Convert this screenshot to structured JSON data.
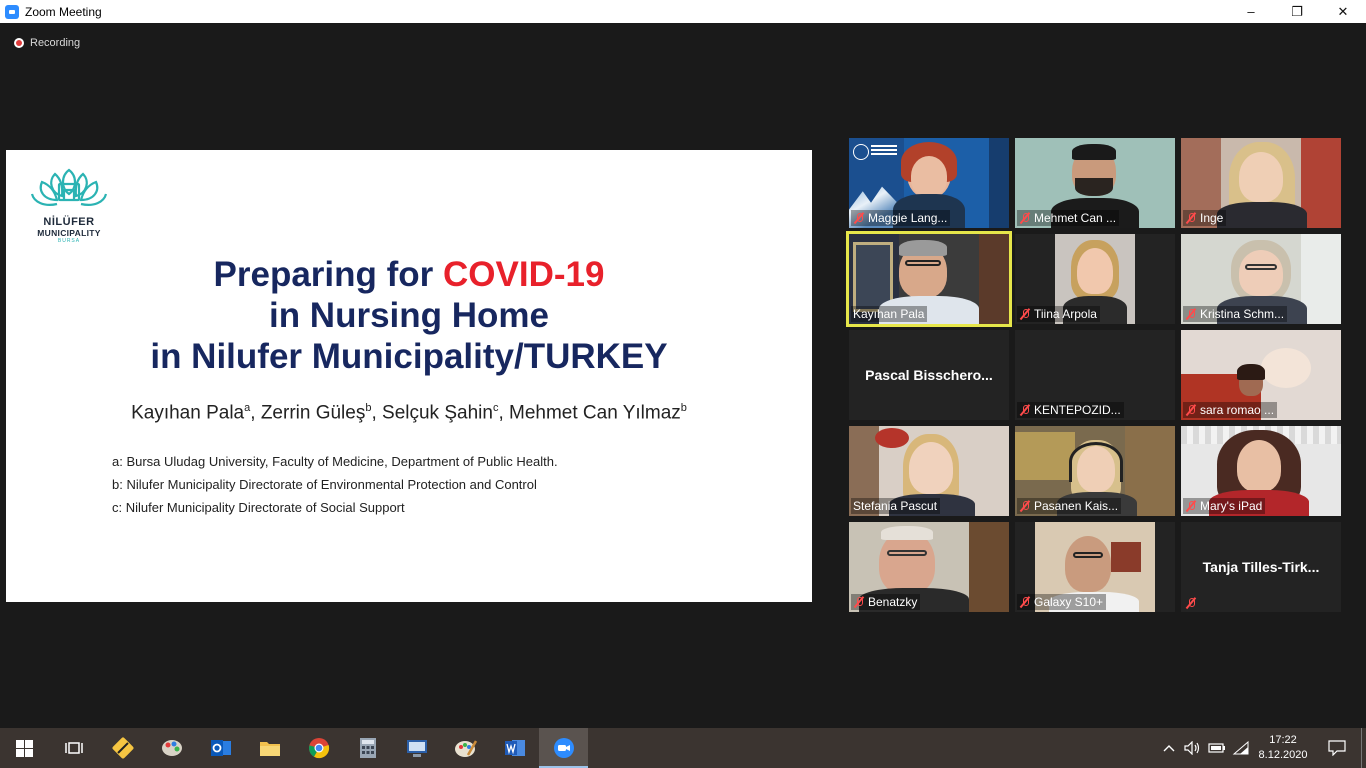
{
  "window": {
    "title": "Zoom Meeting",
    "minimize": "–",
    "restore": "❐",
    "close": "✕"
  },
  "recording": {
    "label": "Recording"
  },
  "slide": {
    "org_line1": "NİLÜFER",
    "org_line2": "MUNICIPALITY",
    "org_line3": "BURSA",
    "title_part1": "Preparing for ",
    "title_highlight": "COVID-19",
    "title_line2": "in Nursing Home",
    "title_line3": "in Nilufer Municipality/TURKEY",
    "authors": [
      {
        "name": "Kayıhan Pala",
        "sup": "a"
      },
      {
        "name": "Zerrin Güleş",
        "sup": "b"
      },
      {
        "name": "Selçuk Şahin",
        "sup": "c"
      },
      {
        "name": "Mehmet Can Yılmaz",
        "sup": "b"
      }
    ],
    "affiliations": [
      "a: Bursa Uludag University, Faculty of Medicine, Department of Public Health.",
      "b: Nilufer Municipality Directorate of Environmental Protection and Control",
      "c:  Nilufer Municipality Directorate of Social Support"
    ]
  },
  "participants": [
    {
      "name": "Maggie Lang...",
      "muted": true,
      "video": true
    },
    {
      "name": "Mehmet Can ...",
      "muted": true,
      "video": true
    },
    {
      "name": "Inge",
      "muted": true,
      "video": true
    },
    {
      "name": "Kayıhan Pala",
      "muted": false,
      "video": true,
      "speaking": true
    },
    {
      "name": "Tiina Arpola",
      "muted": true,
      "video": true
    },
    {
      "name": "Kristina Schm...",
      "muted": true,
      "video": true
    },
    {
      "name": "Pascal  Bisschero...",
      "muted": false,
      "video": false
    },
    {
      "name": "KENTEPOZID...",
      "muted": true,
      "video": false
    },
    {
      "name": "sara romao ...",
      "muted": true,
      "video": true
    },
    {
      "name": "Stefania Pascut",
      "muted": false,
      "video": true
    },
    {
      "name": "Pasanen Kais...",
      "muted": true,
      "video": true
    },
    {
      "name": "Mary's iPad",
      "muted": true,
      "video": true
    },
    {
      "name": "Benatzky",
      "muted": true,
      "video": true
    },
    {
      "name": "Galaxy S10+",
      "muted": true,
      "video": true
    },
    {
      "name": "Tanja  Tilles-Tirk...",
      "muted": true,
      "video": false
    }
  ],
  "taskbar": {
    "time": "17:22",
    "date": "8.12.2020",
    "apps": [
      "start",
      "task-view",
      "app-1",
      "app-2",
      "outlook",
      "file-explorer",
      "chrome",
      "calculator",
      "app-3",
      "paint",
      "word",
      "zoom"
    ]
  },
  "colors": {
    "title_blue": "#17275f",
    "title_red": "#e8212b",
    "speaker_outline": "#e6e64a",
    "teal": "#2bb3b3"
  }
}
